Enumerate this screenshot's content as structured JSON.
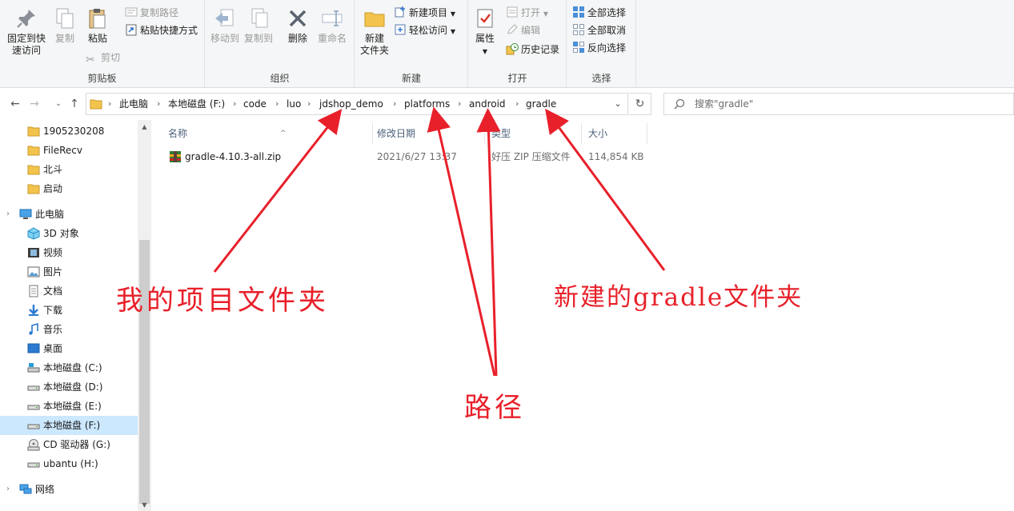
{
  "ribbon": {
    "clipboard": {
      "pin_label_1": "固定到快",
      "pin_label_2": "速访问",
      "copy_label": "复制",
      "paste_label": "粘贴",
      "copy_path_label": "复制路径",
      "paste_shortcut_label": "粘贴快捷方式",
      "cut_label": "剪切",
      "group_label": "剪贴板"
    },
    "organize": {
      "move_to_label": "移动到",
      "copy_to_label": "复制到",
      "delete_label": "删除",
      "rename_label": "重命名",
      "group_label": "组织"
    },
    "new": {
      "new_folder_label_1": "新建",
      "new_folder_label_2": "文件夹",
      "new_item_label": "新建项目",
      "easy_access_label": "轻松访问",
      "group_label": "新建"
    },
    "open": {
      "properties_label": "属性",
      "open_label": "打开",
      "edit_label": "编辑",
      "history_label": "历史记录",
      "group_label": "打开"
    },
    "select": {
      "select_all_label": "全部选择",
      "select_none_label": "全部取消",
      "invert_label": "反向选择",
      "group_label": "选择"
    }
  },
  "breadcrumb": [
    "此电脑",
    "本地磁盘 (F:)",
    "code",
    "luo",
    "jdshop_demo",
    "platforms",
    "android",
    "gradle"
  ],
  "search": {
    "placeholder": "搜索\"gradle\""
  },
  "sidebar": {
    "items": [
      {
        "label": "1905230208",
        "icon": "folder-icon"
      },
      {
        "label": "FileRecv",
        "icon": "folder-icon"
      },
      {
        "label": "北斗",
        "icon": "folder-icon"
      },
      {
        "label": "启动",
        "icon": "folder-icon"
      },
      {
        "label": "此电脑",
        "icon": "this-pc-icon"
      },
      {
        "label": "3D 对象",
        "icon": "3d-objects-icon"
      },
      {
        "label": "视频",
        "icon": "videos-icon"
      },
      {
        "label": "图片",
        "icon": "pictures-icon"
      },
      {
        "label": "文档",
        "icon": "documents-icon"
      },
      {
        "label": "下载",
        "icon": "downloads-icon"
      },
      {
        "label": "音乐",
        "icon": "music-icon"
      },
      {
        "label": "桌面",
        "icon": "desktop-icon"
      },
      {
        "label": "本地磁盘 (C:)",
        "icon": "system-drive-icon"
      },
      {
        "label": "本地磁盘 (D:)",
        "icon": "drive-icon"
      },
      {
        "label": "本地磁盘 (E:)",
        "icon": "drive-icon"
      },
      {
        "label": "本地磁盘 (F:)",
        "icon": "drive-icon"
      },
      {
        "label": "CD 驱动器 (G:)",
        "icon": "cd-drive-icon"
      },
      {
        "label": "ubantu (H:)",
        "icon": "drive-icon"
      },
      {
        "label": "网络",
        "icon": "network-icon"
      }
    ],
    "selected": "本地磁盘 (F:)"
  },
  "columns": {
    "name": "名称",
    "modified": "修改日期",
    "type": "类型",
    "size": "大小"
  },
  "files": [
    {
      "name": "gradle-4.10.3-all.zip",
      "modified": "2021/6/27 13:37",
      "type": "好压 ZIP 压缩文件",
      "size": "114,854 KB"
    }
  ],
  "annotations": {
    "project_folder": "我的项目文件夹",
    "path": "路径",
    "new_gradle_folder": "新建的gradle文件夹"
  },
  "colors": {
    "annotation": "#e8202a",
    "selection": "#cce8ff",
    "folder": "#f3c44c"
  }
}
